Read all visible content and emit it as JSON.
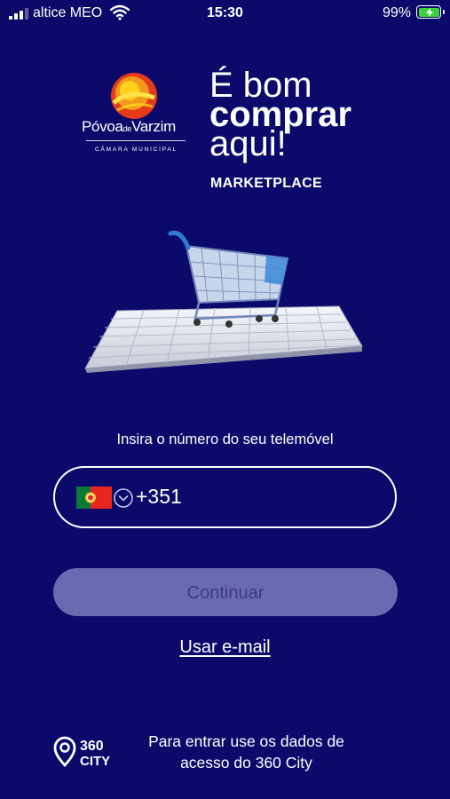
{
  "status_bar": {
    "carrier": "altice MEO",
    "time": "15:30",
    "battery_percent": "99%",
    "battery_charging": true,
    "signal_bars": 3,
    "signal_bars_max": 4
  },
  "branding": {
    "municipality_name_part1": "Póvoa",
    "municipality_name_connector": "de",
    "municipality_name_part2": "Varzim",
    "municipality_subtitle": "CÂMARA MUNICIPAL",
    "slogan_line1": "É bom",
    "slogan_line2": "comprar",
    "slogan_line3": "aqui!",
    "marketplace_label": "MARKETPLACE"
  },
  "login": {
    "phone_prompt": "Insira o número do seu telemóvel",
    "country_flag": "portugal-flag",
    "dial_code": "+351",
    "continue_label": "Continuar",
    "email_link_label": "Usar e-mail"
  },
  "footer": {
    "logo_text_top": "360",
    "logo_text_bottom": "CITY",
    "info_line1": "Para entrar use os dados de",
    "info_line2": "acesso do 360 City"
  },
  "colors": {
    "background": "#0b0a6b",
    "button_bg": "#6a6ab0",
    "button_text": "#3b3a8a",
    "battery_fill": "#3cd23c"
  }
}
